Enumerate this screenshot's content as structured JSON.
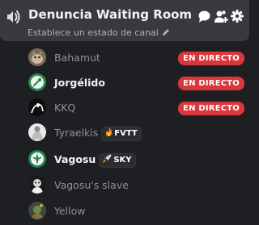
{
  "channel": {
    "title": "Denuncia Waiting Room",
    "subtitle": "Establece un estado de canal",
    "icons": {
      "voice": "voice-channel-icon",
      "edit": "pencil-icon",
      "chat": "chat-bubble-icon",
      "invite": "add-member-icon",
      "settings": "gear-icon"
    }
  },
  "members": [
    {
      "name": "Bahamut",
      "status": "EN DIRECTO",
      "active": false
    },
    {
      "name": "Jorgélido",
      "status": "EN DIRECTO",
      "active": true
    },
    {
      "name": "KKQ",
      "status": "EN DIRECTO",
      "active": false
    },
    {
      "name": "Tyraelkis",
      "tag": "FVTT",
      "tag_icon": "fire-icon",
      "active": false
    },
    {
      "name": "Vagosu",
      "tag": "SKY",
      "tag_icon": "rocket-icon",
      "active": true
    },
    {
      "name": "Vagosu's slave",
      "active": false
    },
    {
      "name": "Yellow",
      "active": false
    }
  ],
  "colors": {
    "background": "#1e1f22",
    "header": "#393a3f",
    "live_badge": "#da373c",
    "active_text": "#f2f3f5",
    "muted_text": "#8e9199"
  }
}
